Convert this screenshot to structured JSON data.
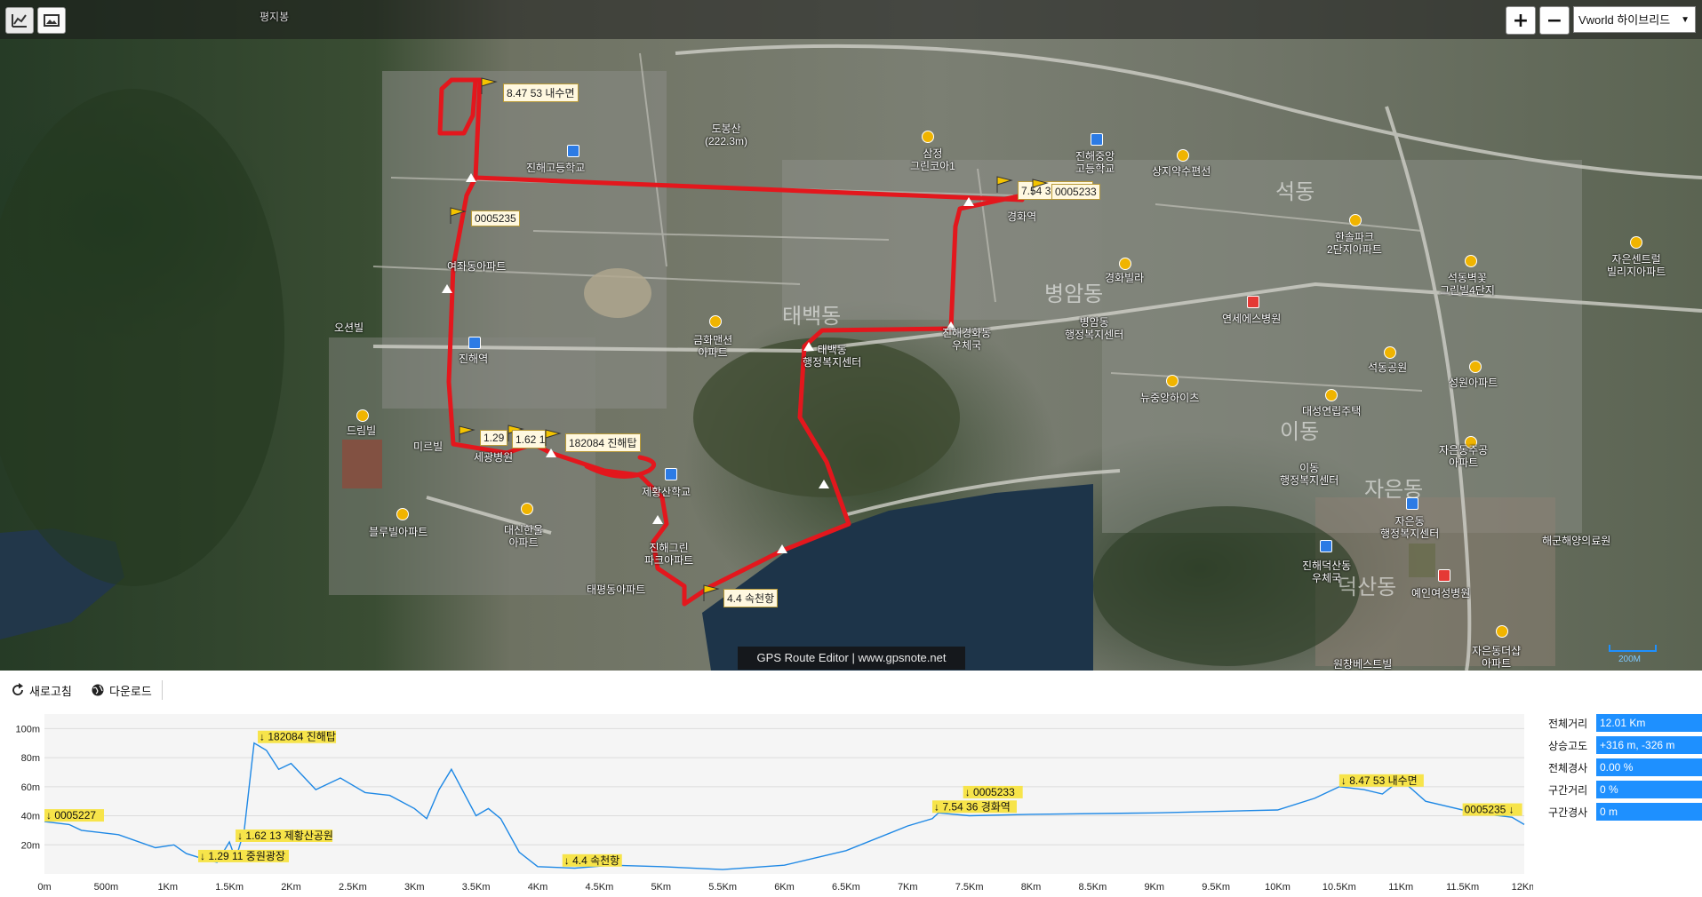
{
  "map": {
    "top_label": "평지봉",
    "layer_select": "Vworld 하이브리드",
    "zoom_in": "+",
    "zoom_out": "−",
    "credit": "GPS Route Editor | www.gpsnote.net",
    "scale_label": "200M",
    "district_labels": [
      "석동",
      "병암동",
      "태백동",
      "이동",
      "자은동",
      "덕산동"
    ],
    "places": [
      {
        "text": "진해고등학교"
      },
      {
        "text": "도봉산\n(222.3m)"
      },
      {
        "text": "삼정\n그린코아1"
      },
      {
        "text": "진해중앙\n고등학교"
      },
      {
        "text": "상지약수편선"
      },
      {
        "text": "경화역"
      },
      {
        "text": "한솔파크\n2단지아파트"
      },
      {
        "text": "석동벽꽃\n그린빌4단지"
      },
      {
        "text": "자은센트럴\n빌리지아파트"
      },
      {
        "text": "여좌동아파트"
      },
      {
        "text": "오션빌"
      },
      {
        "text": "진해역"
      },
      {
        "text": "금화맨션\n아파트"
      },
      {
        "text": "태백동\n행정복지센터"
      },
      {
        "text": "진해경화동\n우체국"
      },
      {
        "text": "병암동\n행정복지센터"
      },
      {
        "text": "연세에스병원"
      },
      {
        "text": "경화빌라"
      },
      {
        "text": "석동공원"
      },
      {
        "text": "성원아파트"
      },
      {
        "text": "뉴중앙하이츠"
      },
      {
        "text": "대성연립주택"
      },
      {
        "text": "자은동주공\n아파트"
      },
      {
        "text": "이동\n행정복지센터"
      },
      {
        "text": "자은동\n행정복지센터"
      },
      {
        "text": "해군해양의료원"
      },
      {
        "text": "드림빌"
      },
      {
        "text": "미르빌"
      },
      {
        "text": "세광병원"
      },
      {
        "text": "블루빌아파트"
      },
      {
        "text": "대신한울\n아파트"
      },
      {
        "text": "태평동아파트"
      },
      {
        "text": "진해그린\n파크아파트"
      },
      {
        "text": "진해덕산동\n우체국"
      },
      {
        "text": "예인여성병원"
      },
      {
        "text": "원창베스트빌"
      },
      {
        "text": "자은동더샵\n아파트"
      },
      {
        "text": "제황산학교"
      }
    ],
    "waypoints": [
      {
        "label": "8.47 53 내수면"
      },
      {
        "label": "0005235"
      },
      {
        "label": "7.54 36 경화역"
      },
      {
        "label": "0005233"
      },
      {
        "label": "1.29"
      },
      {
        "label": "1.62 13 제황산공원"
      },
      {
        "label": "182084 진해탑"
      },
      {
        "label": "4.4 속천항"
      }
    ]
  },
  "toolbar": {
    "refresh_label": "새로고침",
    "download_label": "다운로드"
  },
  "profile": {
    "y_ticks": [
      "100m",
      "80m",
      "60m",
      "40m",
      "20m"
    ],
    "x_ticks": [
      "0m",
      "500m",
      "1Km",
      "1.5Km",
      "2Km",
      "2.5Km",
      "3Km",
      "3.5Km",
      "4Km",
      "4.5Km",
      "5Km",
      "5.5Km",
      "6Km",
      "6.5Km",
      "7Km",
      "7.5Km",
      "8Km",
      "8.5Km",
      "9Km",
      "9.5Km",
      "10Km",
      "10.5Km",
      "11Km",
      "11.5Km",
      "12Km"
    ],
    "labels": {
      "start": "↓ 0005227",
      "p129": "↓ 1.29 11 중원광장",
      "p162": "↓ 1.62 13 제황산공원",
      "p182": "↓ 182084 진해탑",
      "p44": "↓ 4.4 속천항",
      "p754": "↓ 7.54 36 경화역",
      "p5233": "↓ 0005233",
      "p847": "↓ 8.47 53 내수면",
      "end": "0005235 ↓"
    }
  },
  "chart_data": {
    "type": "line",
    "xlabel": "",
    "ylabel": "",
    "xlim_km": [
      0,
      12
    ],
    "ylim_m": [
      0,
      110
    ],
    "x_km": [
      0,
      0.2,
      0.3,
      0.6,
      0.9,
      1.05,
      1.15,
      1.3,
      1.4,
      1.5,
      1.55,
      1.62,
      1.7,
      1.8,
      1.9,
      2.0,
      2.2,
      2.4,
      2.6,
      2.8,
      3.0,
      3.1,
      3.2,
      3.3,
      3.5,
      3.6,
      3.7,
      3.85,
      4.0,
      4.3,
      4.6,
      5.0,
      5.5,
      6.0,
      6.5,
      7.0,
      7.2,
      7.25,
      7.5,
      8.0,
      9.0,
      10.0,
      10.3,
      10.5,
      10.7,
      10.85,
      11.0,
      11.2,
      11.6,
      11.9,
      12.0
    ],
    "y_m": [
      36,
      34,
      30,
      27,
      18,
      20,
      14,
      10,
      8,
      22,
      10,
      30,
      90,
      85,
      72,
      76,
      58,
      66,
      56,
      54,
      45,
      38,
      58,
      72,
      40,
      45,
      38,
      15,
      5,
      4,
      6,
      5,
      3,
      6,
      16,
      33,
      38,
      42,
      40,
      41,
      42,
      44,
      52,
      60,
      58,
      55,
      65,
      50,
      42,
      39,
      34
    ]
  },
  "stats": [
    {
      "label": "전체거리",
      "value": "12.01 Km"
    },
    {
      "label": "상승고도",
      "value": "+316 m, -326 m"
    },
    {
      "label": "전체경사",
      "value": "0.00 %"
    },
    {
      "label": "구간거리",
      "value": "0 %"
    },
    {
      "label": "구간경사",
      "value": "0 m"
    }
  ]
}
